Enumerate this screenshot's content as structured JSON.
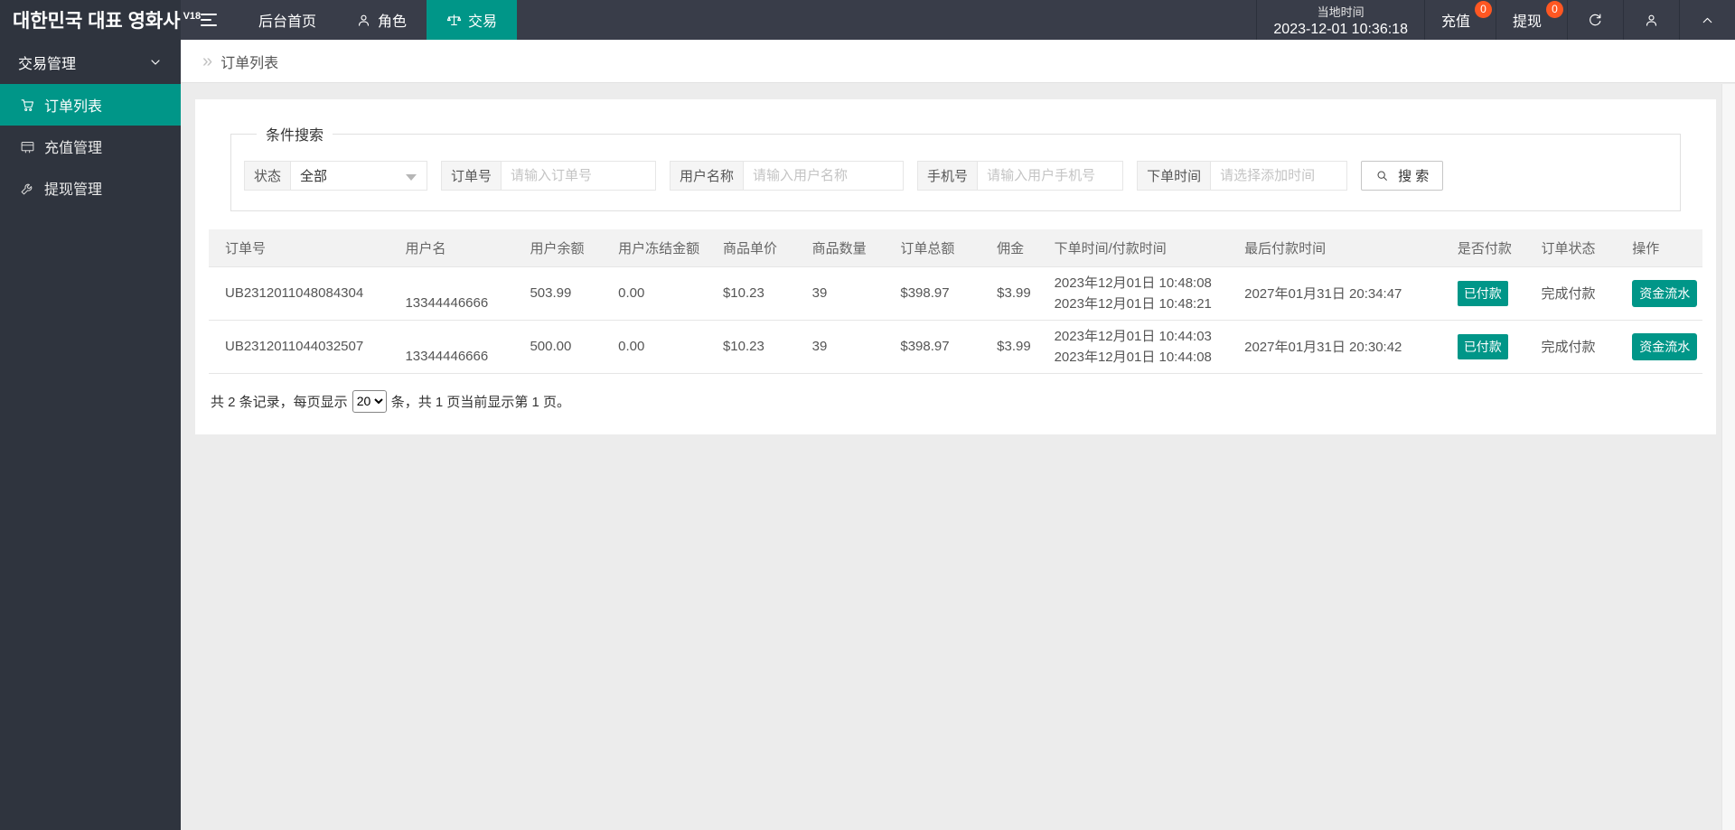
{
  "header": {
    "logo": "대한민국 대표 영화사",
    "logo_version": "V18",
    "nav": {
      "home": "后台首页",
      "role": "角色",
      "trade": "交易"
    },
    "local_time_label": "当地时间",
    "local_time_value": "2023-12-01 10:36:18",
    "recharge_label": "充值",
    "recharge_badge": "0",
    "withdraw_label": "提现",
    "withdraw_badge": "0"
  },
  "sidebar": {
    "group_label": "交易管理",
    "items": [
      {
        "label": "订单列表",
        "icon": "cart-icon",
        "active": true
      },
      {
        "label": "充值管理",
        "icon": "card-icon",
        "active": false
      },
      {
        "label": "提现管理",
        "icon": "wrench-icon",
        "active": false
      }
    ]
  },
  "breadcrumb": {
    "icon": "double-chevron-right",
    "label": "订单列表"
  },
  "search": {
    "legend": "条件搜索",
    "status_label": "状态",
    "status_value": "全部",
    "order_no_label": "订单号",
    "order_no_placeholder": "请输入订单号",
    "username_label": "用户名称",
    "username_placeholder": "请输入用户名称",
    "phone_label": "手机号",
    "phone_placeholder": "请输入用户手机号",
    "time_label": "下单时间",
    "time_placeholder": "请选择添加时间",
    "search_button": "搜 索"
  },
  "table": {
    "headers": [
      "订单号",
      "用户名",
      "用户余额",
      "用户冻结金额",
      "商品单价",
      "商品数量",
      "订单总额",
      "佣金",
      "下单时间/付款时间",
      "最后付款时间",
      "是否付款",
      "订单状态",
      "操作"
    ],
    "rows": [
      {
        "order_no": "UB2312011048084304",
        "username": "13344446666",
        "balance": "503.99",
        "frozen": "0.00",
        "unit_price": "$10.23",
        "quantity": "39",
        "total": "$398.97",
        "commission": "$3.99",
        "order_time": "2023年12月01日 10:48:08",
        "pay_time": "2023年12月01日 10:48:21",
        "last_pay_time": "2027年01月31日 20:34:47",
        "paid_badge": "已付款",
        "status": "完成付款",
        "action": "资金流水"
      },
      {
        "order_no": "UB2312011044032507",
        "username": "13344446666",
        "balance": "500.00",
        "frozen": "0.00",
        "unit_price": "$10.23",
        "quantity": "39",
        "total": "$398.97",
        "commission": "$3.99",
        "order_time": "2023年12月01日 10:44:03",
        "pay_time": "2023年12月01日 10:44:08",
        "last_pay_time": "2027年01月31日 20:30:42",
        "paid_badge": "已付款",
        "status": "完成付款",
        "action": "资金流水"
      }
    ]
  },
  "pagination": {
    "prefix": "共 2 条记录，每页显示",
    "page_size": "20",
    "suffix": "条，共 1 页当前显示第 1 页。"
  },
  "colors": {
    "accent": "#009688",
    "badge": "#ff5722",
    "topbar_bg": "#393d49",
    "sidebar_bg": "#2f343e",
    "content_bg": "#ececec"
  },
  "icons": {
    "hamburger": "menu-toggle",
    "user": "person outline",
    "scales": "balance scales",
    "cart": "shopping cart",
    "card": "payment card",
    "wrench": "wrench",
    "refresh": "circular arrow",
    "chevron_up": "up chevron",
    "chevron_down": "down chevron",
    "search": "magnifier",
    "breadcrumb": "»"
  }
}
